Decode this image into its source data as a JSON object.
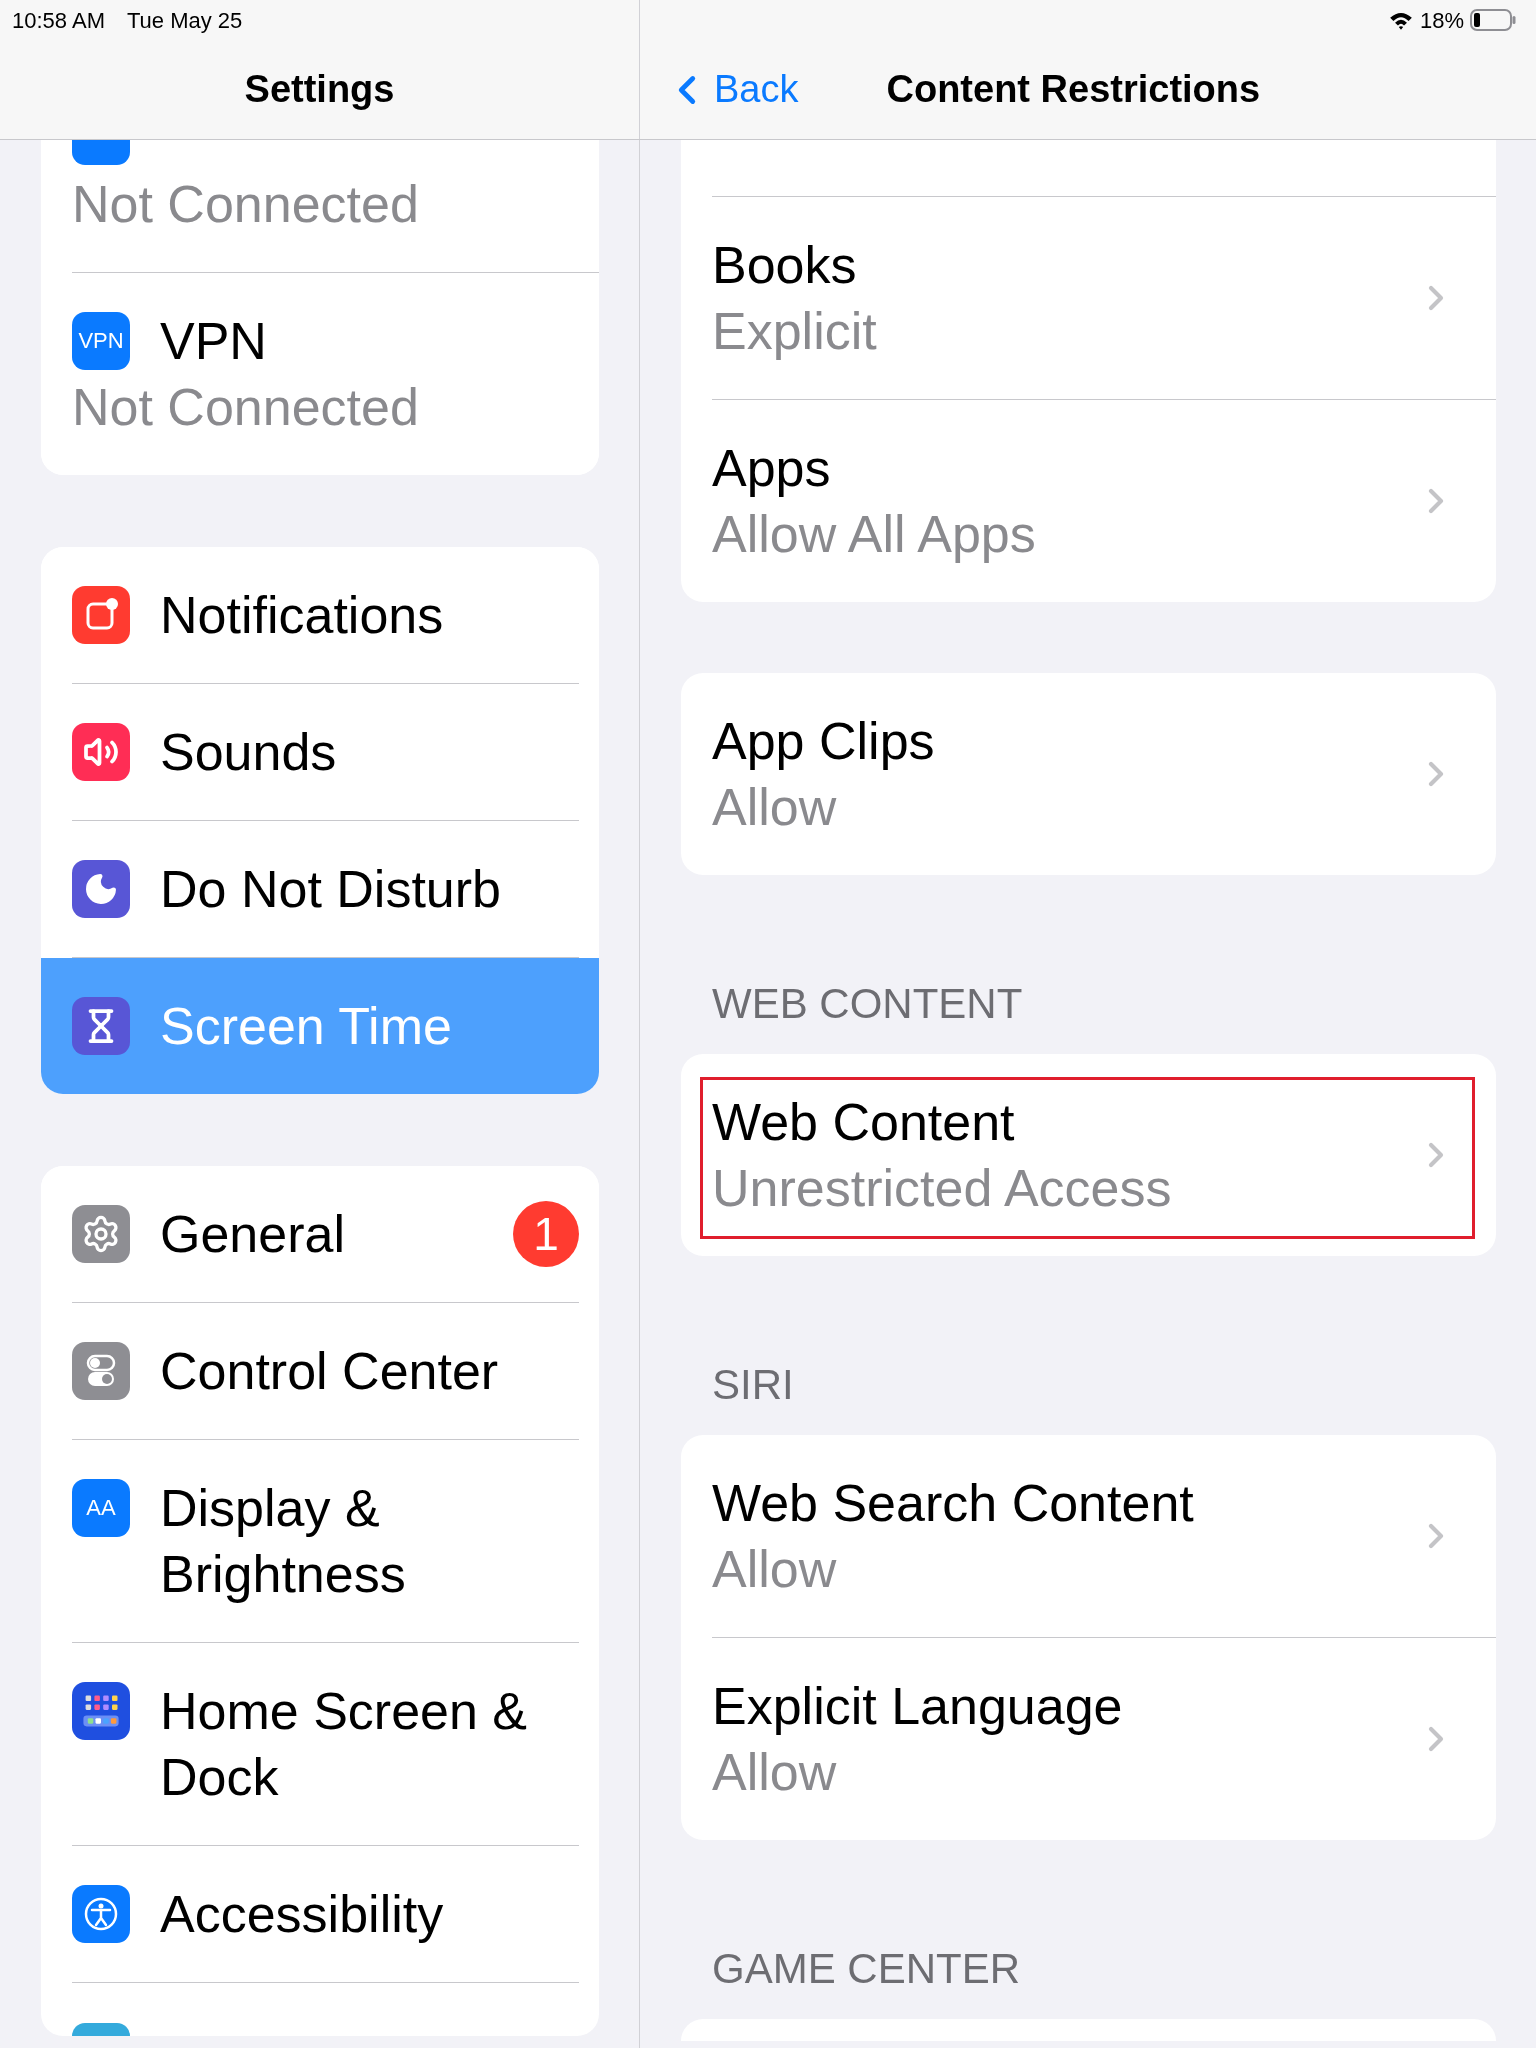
{
  "status_bar": {
    "time": "10:58 AM",
    "date": "Tue May 25",
    "battery": "18%"
  },
  "sidebar": {
    "title": "Settings",
    "groups": [
      {
        "items": [
          {
            "kind": "stub",
            "subtitle": "Not Connected"
          },
          {
            "kind": "row",
            "icon_text": "VPN",
            "label": "VPN",
            "subtitle": "Not Connected",
            "selected": false
          }
        ]
      },
      {
        "items": [
          {
            "kind": "row",
            "label": "Notifications",
            "selected": false
          },
          {
            "kind": "row",
            "label": "Sounds",
            "selected": false
          },
          {
            "kind": "row",
            "label": "Do Not Disturb",
            "selected": false
          },
          {
            "kind": "row",
            "label": "Screen Time",
            "selected": true
          }
        ]
      },
      {
        "items": [
          {
            "kind": "row",
            "label": "General",
            "badge": "1",
            "selected": false
          },
          {
            "kind": "row",
            "label": "Control Center",
            "selected": false
          },
          {
            "kind": "row",
            "icon_text": "AA",
            "label": "Display & Brightness",
            "selected": false
          },
          {
            "kind": "row",
            "label": "Home Screen & Dock",
            "selected": false
          },
          {
            "kind": "row",
            "label": "Accessibility",
            "selected": false
          },
          {
            "kind": "stub"
          }
        ]
      }
    ]
  },
  "detail": {
    "back": "Back",
    "title": "Content Restrictions",
    "sections": [
      {
        "clipped_top": true,
        "rows": [
          {
            "title": "Books",
            "subtitle": "Explicit",
            "highlighted": false
          },
          {
            "title": "Apps",
            "subtitle": "Allow All Apps",
            "highlighted": false
          }
        ]
      },
      {
        "rows": [
          {
            "title": "App Clips",
            "subtitle": "Allow",
            "highlighted": false
          }
        ]
      },
      {
        "header": "WEB CONTENT",
        "rows": [
          {
            "title": "Web Content",
            "subtitle": "Unrestricted Access",
            "highlighted": true
          }
        ]
      },
      {
        "header": "SIRI",
        "rows": [
          {
            "title": "Web Search Content",
            "subtitle": "Allow",
            "highlighted": false
          },
          {
            "title": "Explicit Language",
            "subtitle": "Allow",
            "highlighted": false
          }
        ]
      },
      {
        "header": "GAME CENTER"
      }
    ]
  }
}
